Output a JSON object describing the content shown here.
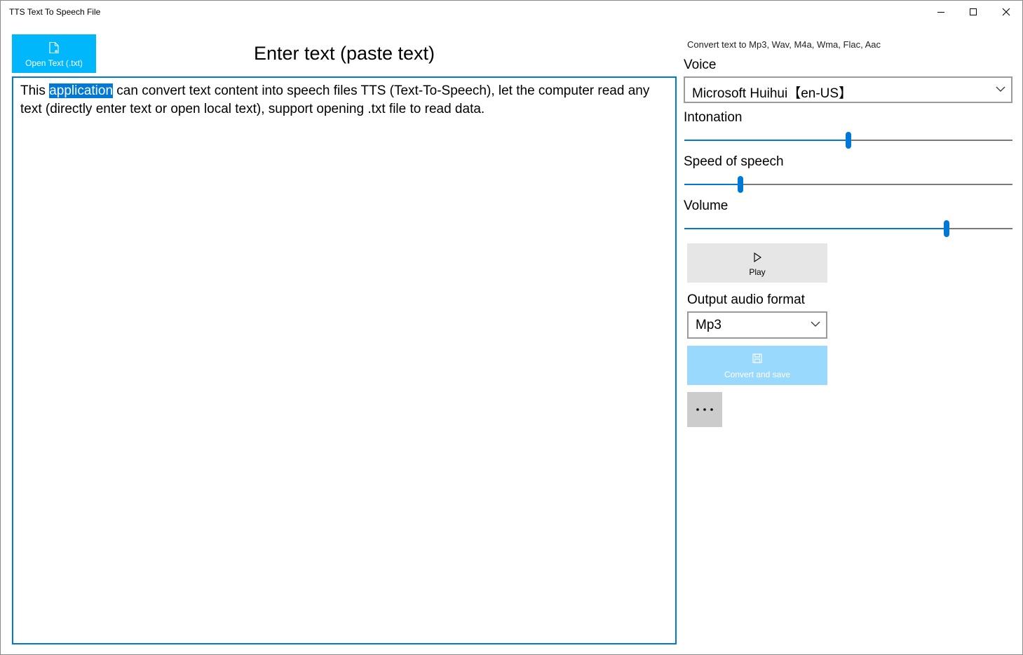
{
  "window": {
    "title": "TTS Text To Speech File"
  },
  "toolbar": {
    "open_label": "Open Text (.txt)"
  },
  "editor": {
    "heading": "Enter text (paste text)",
    "text_before": "This ",
    "text_selected": "application",
    "text_after": " can convert text content into speech files TTS (Text-To-Speech), let the computer read any text (directly enter text or open local text), support opening .txt file to read data."
  },
  "side": {
    "hint": "Convert text to Mp3, Wav, M4a, Wma, Flac, Aac",
    "voice_label": "Voice",
    "voice_value": "Microsoft Huihui【en-US】",
    "intonation_label": "Intonation",
    "intonation_level": 0.5,
    "speed_label": "Speed of speech",
    "speed_level": 0.17,
    "volume_label": "Volume",
    "volume_level": 0.8,
    "play_label": "Play",
    "format_label": "Output audio format",
    "format_value": "Mp3",
    "save_label": "Convert and save"
  },
  "colors": {
    "accent": "#0078d7",
    "open_button": "#00b7fb",
    "save_button_disabled": "#99d9fd"
  }
}
